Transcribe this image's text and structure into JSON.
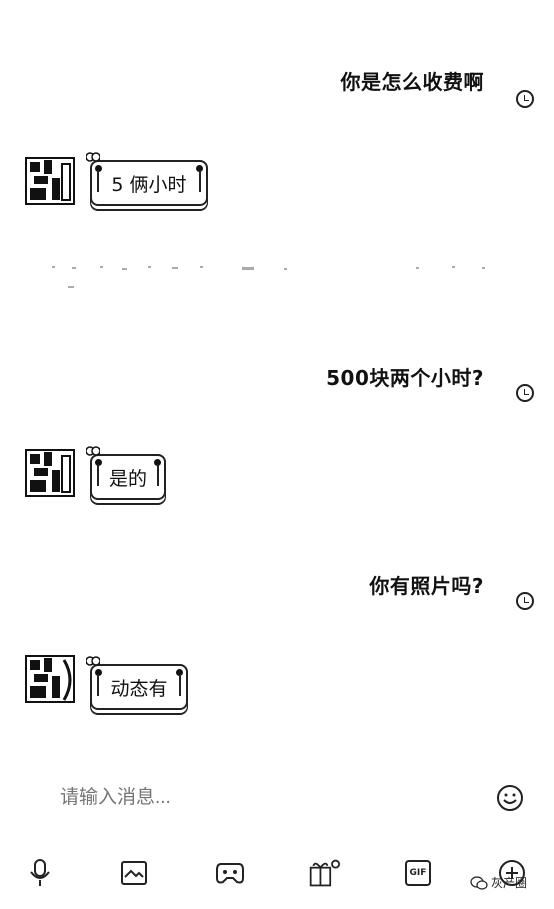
{
  "messages": [
    {
      "side": "right",
      "text": "你是怎么收费啊"
    },
    {
      "side": "left",
      "text": "5 俩小时"
    },
    {
      "side": "right",
      "text": "500块两个小时?"
    },
    {
      "side": "left",
      "text": "是的"
    },
    {
      "side": "right",
      "text": "你有照片吗?"
    },
    {
      "side": "left",
      "text": "动态有"
    }
  ],
  "input": {
    "placeholder": "请输入消息..."
  },
  "toolbar": {
    "icons": [
      "microphone-icon",
      "image-icon",
      "gamepad-icon",
      "gift-icon",
      "gif-icon",
      "plus-icon"
    ],
    "gif_label": "GIF"
  },
  "watermark": {
    "text": "灰产圈"
  }
}
